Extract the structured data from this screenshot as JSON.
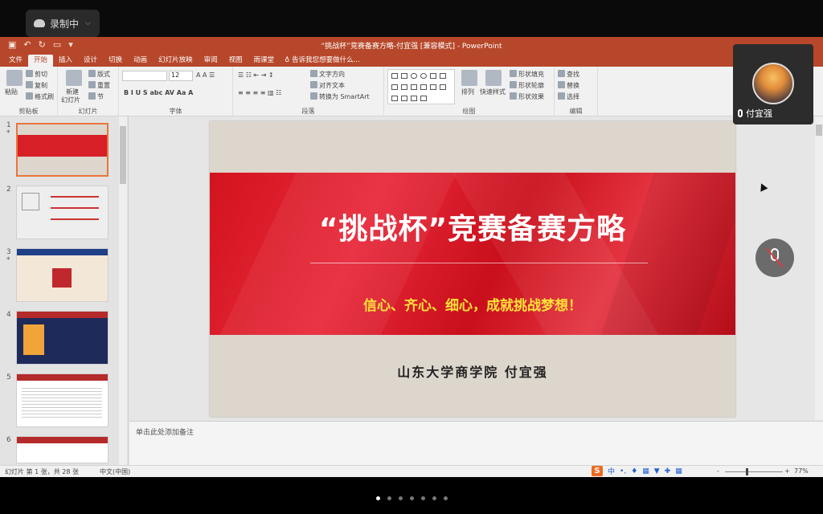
{
  "recording": {
    "label": "录制中"
  },
  "window": {
    "title": "“挑战杯”竞赛备赛方略-付宜强 [兼容模式] - PowerPoint"
  },
  "tabs": [
    "文件",
    "开始",
    "插入",
    "设计",
    "切换",
    "动画",
    "幻灯片放映",
    "审阅",
    "视图",
    "雨课堂"
  ],
  "active_tab": "开始",
  "tell_me": "告诉我您想要做什么...",
  "ribbon": {
    "clipboard": {
      "label": "剪贴板",
      "paste": "粘贴",
      "cut": "剪切",
      "copy": "复制",
      "format_painter": "格式刷"
    },
    "slides": {
      "label": "幻灯片",
      "new_slide": "新建",
      "new_slide_2": "幻灯片",
      "layout": "版式",
      "reset": "重置",
      "section": "节"
    },
    "font": {
      "label": "字体",
      "size": "12"
    },
    "paragraph": {
      "label": "段落",
      "text_direction": "文字方向",
      "align_text": "对齐文本",
      "smartart": "转换为 SmartArt"
    },
    "drawing": {
      "label": "绘图",
      "arrange": "排列",
      "quick_styles": "快速样式",
      "fill": "形状填充",
      "outline": "形状轮廓",
      "effects": "形状效果"
    },
    "editing": {
      "label": "编辑",
      "find": "查找",
      "replace": "替换",
      "select": "选择"
    }
  },
  "thumbnails": [
    {
      "num": "1",
      "star": "*"
    },
    {
      "num": "2",
      "star": ""
    },
    {
      "num": "3",
      "star": "*"
    },
    {
      "num": "4",
      "star": ""
    },
    {
      "num": "5",
      "star": ""
    },
    {
      "num": "6",
      "star": ""
    }
  ],
  "slide": {
    "title": "“挑战杯”竞赛备赛方略",
    "subtitle": "信心、齐心、细心，成就挑战梦想！",
    "author": "山东大学商学院  付宜强"
  },
  "notes_placeholder": "单击此处添加备注",
  "status": {
    "slide_info": "幻灯片 第 1 张，共 28 张",
    "language": "中文(中国)",
    "ime": "中",
    "zoom": "77%"
  },
  "participant": {
    "name": "付宜强"
  },
  "page_dots": 7,
  "active_dot": 0
}
